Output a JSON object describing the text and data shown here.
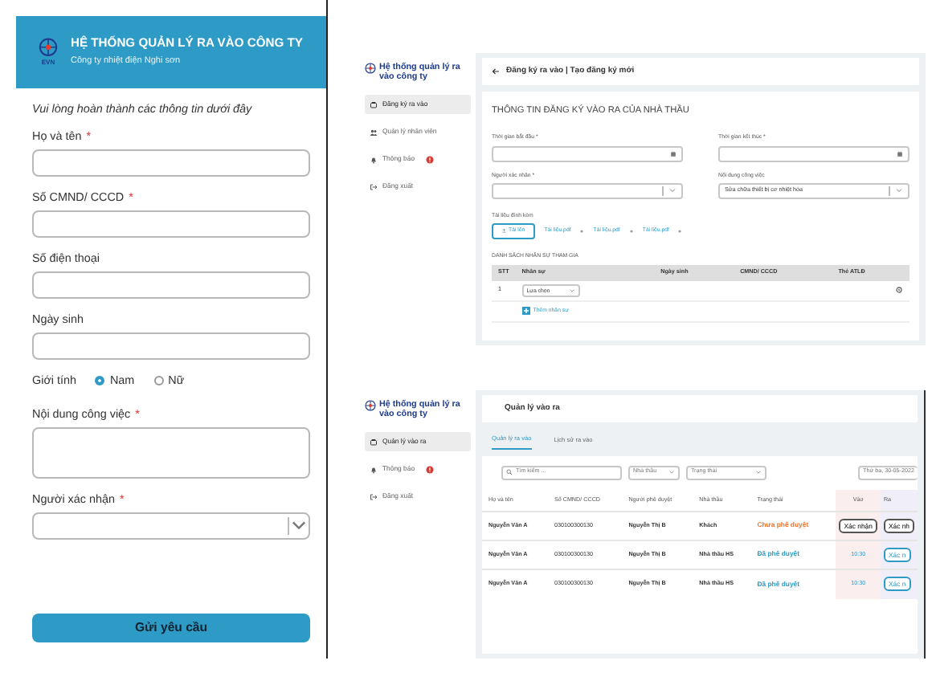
{
  "mobile_form": {
    "header": {
      "title": "HỆ THỐNG QUẢN LÝ RA VÀO CÔNG TY",
      "subtitle": "Công ty nhiệt điện Nghi sơn",
      "logo_text": "EVN"
    },
    "intro": "Vui lòng hoàn thành các thông tin dưới đây",
    "fields": [
      {
        "kind": "text",
        "label": "Họ và tên",
        "required_mark": "*"
      },
      {
        "kind": "text",
        "label": "Số CMND/ CCCD",
        "required_mark": "*"
      },
      {
        "kind": "text",
        "label": "Số điện thoại"
      },
      {
        "kind": "text",
        "label": "Ngày sinh"
      },
      {
        "kind": "radio",
        "label": "Giới tính",
        "options": [
          {
            "label": "Nam",
            "selected": true
          },
          {
            "label": "Nữ",
            "selected": false
          }
        ]
      },
      {
        "kind": "textarea",
        "label": "Nội dung công việc",
        "required_mark": "*"
      },
      {
        "kind": "select",
        "label": "Người xác nhận",
        "required_mark": "*"
      }
    ],
    "submit": "Gửi yêu cầu"
  },
  "registration_screen": {
    "brand": "Hệ thống quản lý ra vào công ty",
    "sidebar": {
      "items": [
        {
          "label": "Đăng ký ra vào",
          "selected": true,
          "alert": false
        },
        {
          "label": "Quản lý nhân viên",
          "selected": false,
          "alert": false
        },
        {
          "label": "Thông báo",
          "selected": false,
          "alert": true
        },
        {
          "label": "Đăng xuất",
          "selected": false,
          "alert": false
        }
      ]
    },
    "page_title": "Đăng ký ra vào | Tạo đăng ký mới",
    "form_title": "THÔNG TIN ĐĂNG KÝ VÀO RA CỦA NHÀ THẦU",
    "fields": [
      {
        "kind": "date",
        "label": "Thời gian bắt đầu *"
      },
      {
        "kind": "date",
        "label": "Thời gian kết thúc *"
      },
      {
        "kind": "select",
        "label": "Người xác nhận *"
      },
      {
        "kind": "select",
        "label": "Nội dung công việc",
        "value": "Sửa chữa thiết bị cơ nhiệt hóa"
      }
    ],
    "attachments": {
      "label": "Tài liệu đính kèm",
      "upload_button": "Tải lên",
      "files": [
        "Tài liệu.pdf",
        "Tài liệu.pdf",
        "Tài liệu.pdf"
      ]
    },
    "staff_table": {
      "title": "DANH SÁCH NHÂN SỰ THAM GIA",
      "columns": [
        "STT",
        "Nhân sự",
        "Ngày sinh",
        "CMND/ CCCD",
        "Thẻ ATLĐ"
      ],
      "rows": [
        {
          "index": "1",
          "staff_placeholder": "Lựa chọn"
        }
      ],
      "add_link": "Thêm nhân sự"
    }
  },
  "management_screen": {
    "brand": "Hệ thống quản lý ra vào công ty",
    "sidebar": {
      "items": [
        {
          "label": "Quản lý vào ra",
          "selected": true,
          "alert": false
        },
        {
          "label": "Thông báo",
          "selected": false,
          "alert": true
        },
        {
          "label": "Đăng xuất",
          "selected": false,
          "alert": false
        }
      ]
    },
    "page_title": "Quản lý vào ra",
    "tabs": [
      {
        "label": "Quản lý ra vào",
        "selected": true
      },
      {
        "label": "Lịch sử ra vào",
        "selected": false
      }
    ],
    "search": {
      "placeholder": "Tìm kiếm ..."
    },
    "filters": [
      "Nhà thầu",
      "Trạng thái"
    ],
    "date": "Thứ ba, 30-05-2022",
    "table": {
      "columns": [
        "Họ và tên",
        "Số CMND/ CCCD",
        "Người phê duyệt",
        "Nhà thầu",
        "Trạng thái",
        "Vào",
        "Ra"
      ],
      "rows": [
        {
          "name": "Nguyễn Văn A",
          "id_number": "030100300130",
          "approver": "Nguyễn Thị B",
          "contractor": "Khách",
          "status": "Chưa phê duyệt",
          "color": "#e8732a",
          "in": {
            "kind": "button",
            "text": "Xác nhận"
          },
          "out": {
            "kind": "button",
            "text": "Xác nh"
          }
        },
        {
          "name": "Nguyễn Văn A",
          "id_number": "030100300130",
          "approver": "Nguyễn Thị B",
          "contractor": "Nhà thầu HS",
          "status": "Đã phê duyệt",
          "color": "#2e9bc6",
          "in": {
            "kind": "time",
            "text": "10:30"
          },
          "out": {
            "kind": "button",
            "text": "Xác n"
          }
        },
        {
          "name": "Nguyễn Văn A",
          "id_number": "030100300130",
          "approver": "Nguyễn Thị B",
          "contractor": "Nhà thầu HS",
          "status": "Đã phê duyệt",
          "color": "#2e9bc6",
          "in": {
            "kind": "time",
            "text": "10:30"
          },
          "out": {
            "kind": "button",
            "text": "Xác n"
          }
        }
      ]
    }
  }
}
